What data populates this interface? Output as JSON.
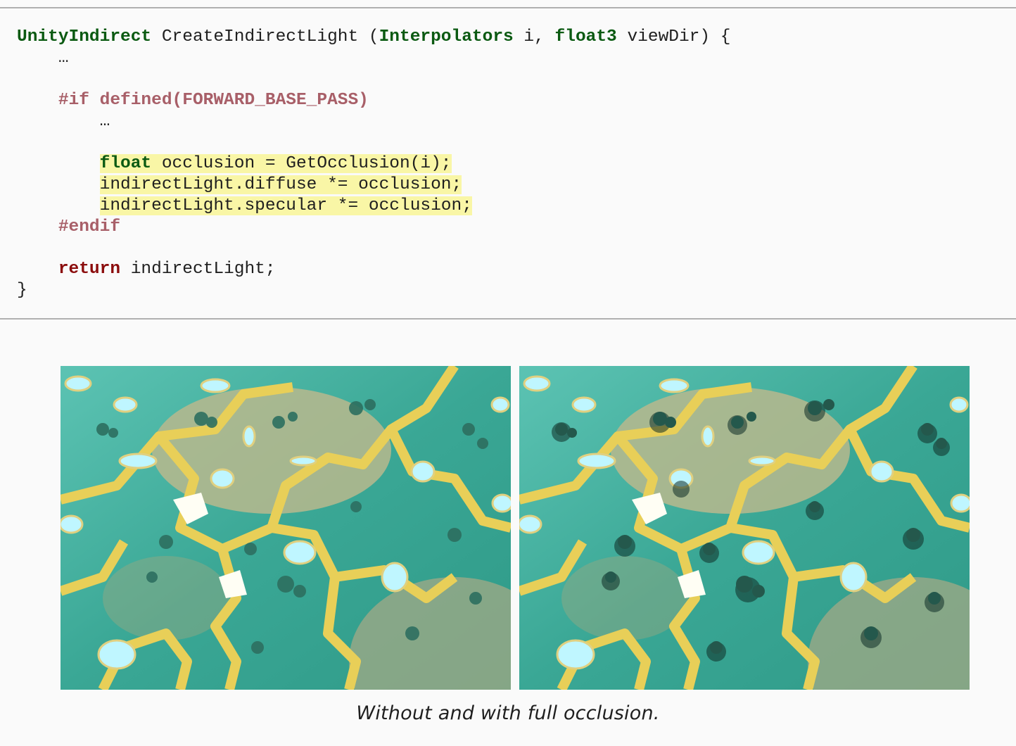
{
  "code": {
    "l1": {
      "ret_type": "UnityIndirect",
      "fn": " CreateIndirectLight (",
      "param_type": "Interpolators",
      "param_name": " i, ",
      "param2_type": "float3",
      "tail": " viewDir) {"
    },
    "l2": "…",
    "l4": {
      "directive": "#if defined(FORWARD_BASE_PASS)"
    },
    "l5": "…",
    "l7": {
      "type": "float",
      "rest": " occlusion = GetOcclusion(i);"
    },
    "l8": "indirectLight.diffuse *= occlusion;",
    "l9": "indirectLight.specular *= occlusion;",
    "l10": "#endif",
    "l12": {
      "keyword": "return",
      "rest": " indirectLight;"
    },
    "l13": "}"
  },
  "figure": {
    "caption": "Without and with full occlusion."
  },
  "colors": {
    "code_type": "#0b5a12",
    "code_preprocessor": "#a85f68",
    "code_return": "#8b0c0c",
    "highlight": "#f9f6a6",
    "ground_teal": "#3fae9e",
    "gold_path": "#e8cf58"
  }
}
